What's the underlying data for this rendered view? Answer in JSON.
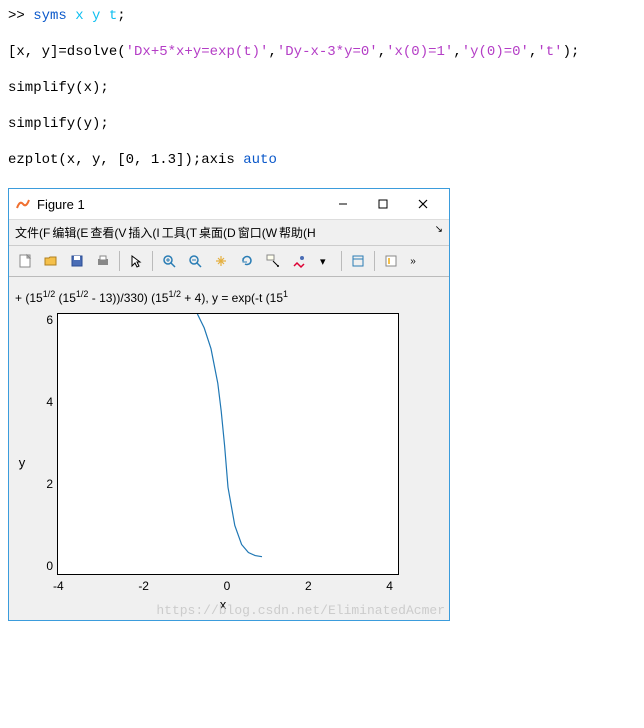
{
  "code": {
    "line1_prefix": ">> ",
    "line1_kw": "syms",
    "line1_vars": "x y t",
    "line1_end": ";",
    "line2_a": "[x, y]=dsolve(",
    "line2_s1": "'Dx+5*x+y=exp(t)'",
    "line2_c1": ",",
    "line2_s2": "'Dy-x-3*y=0'",
    "line2_c2": ",",
    "line2_s3": "'x(0)=1'",
    "line2_c3": ",",
    "line2_s4": "'y(0)=0'",
    "line2_c4": ",",
    "line2_s5": "'t'",
    "line2_b": ");",
    "line3": "simplify(x);",
    "line4": "simplify(y);",
    "line5_a": "ezplot(x, y, [0, 1.3]);axis ",
    "line5_kw": "auto"
  },
  "figure": {
    "title": "Figure 1",
    "menus": {
      "file": "文件(F",
      "edit": "编辑(E",
      "view": "查看(V",
      "insert": "插入(I",
      "tools": "工具(T",
      "desktop": "桌面(D",
      "window": "窗口(W",
      "help": "帮助(H",
      "overflow": "↘"
    },
    "plot_title_html": "+ (15<sup>1/2</sup> (15<sup>1/2</sup> - 13))/330) (15<sup>1/2</sup> + 4), y = exp(-t (15<sup>1</sup>",
    "ylabel": "y",
    "xlabel": "x",
    "yticks": [
      "6",
      "4",
      "2",
      "0"
    ],
    "xticks": [
      "-4",
      "-2",
      "0",
      "2",
      "4"
    ]
  },
  "chart_data": {
    "type": "line",
    "title": "+ (15^{1/2} (15^{1/2} - 13))/330) (15^{1/2} + 4), y = exp(-t (15^{1...",
    "xlabel": "x",
    "ylabel": "y",
    "xlim": [
      -5,
      5
    ],
    "ylim": [
      -0.5,
      7
    ],
    "xticks": [
      -4,
      -2,
      0,
      2,
      4
    ],
    "yticks": [
      0,
      2,
      4,
      6
    ],
    "series": [
      {
        "name": "curve",
        "x": [
          -0.9,
          -0.7,
          -0.5,
          -0.3,
          -0.2,
          -0.1,
          0.0,
          0.2,
          0.4,
          0.6,
          0.8,
          1.0
        ],
        "y": [
          7.0,
          6.6,
          6.0,
          5.0,
          4.2,
          3.2,
          2.0,
          0.9,
          0.35,
          0.12,
          0.03,
          0.0
        ]
      }
    ]
  },
  "watermark": "https://blog.csdn.net/EliminatedAcmer"
}
